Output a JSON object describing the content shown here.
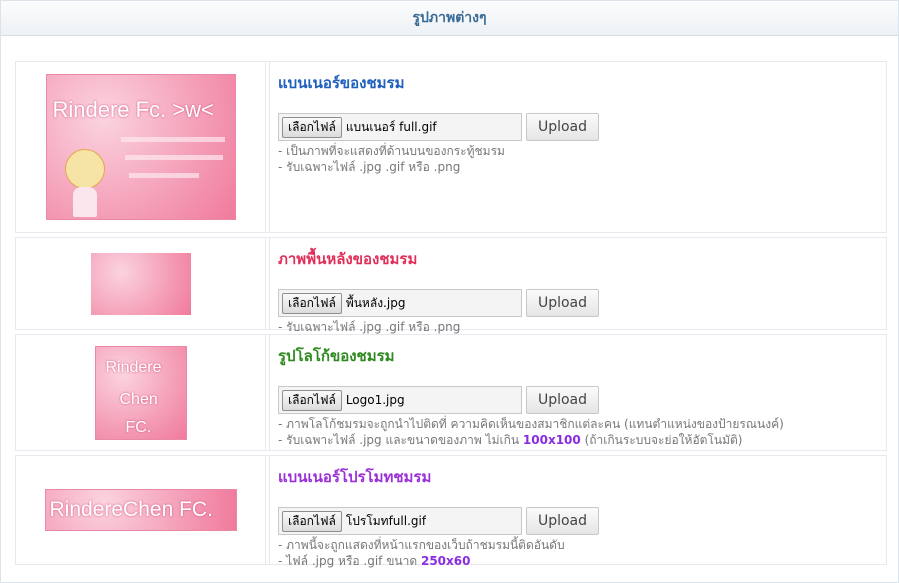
{
  "panel": {
    "title": "รูปภาพต่างๆ"
  },
  "colors": {
    "header_text": "#3a6b96",
    "blue": "#1f5fbf",
    "red": "#e0305a",
    "green": "#2e8a1f",
    "purple": "#9b30d9"
  },
  "rows": [
    {
      "heading": "แบนเนอร์ของชมรม",
      "choose_label": "เลือกไฟล์",
      "file_name": "แบนเนอร์ full.gif",
      "upload_label": "Upload",
      "notes": [
        "- เป็นภาพที่จะแสดงที่ด้านบนของกระทู้ชมรม",
        "- รับเฉพาะไฟล์ .jpg .gif หรือ .png"
      ],
      "thumb_text": "Rindere Fc. >w<"
    },
    {
      "heading": "ภาพพื้นหลังของชมรม",
      "choose_label": "เลือกไฟล์",
      "file_name": "พื้นหลัง.jpg",
      "upload_label": "Upload",
      "notes": [
        "- รับเฉพาะไฟล์ .jpg .gif หรือ .png"
      ]
    },
    {
      "heading": "รูปโลโก้ของชมรม",
      "choose_label": "เลือกไฟล์",
      "file_name": "Logo1.jpg",
      "upload_label": "Upload",
      "note1": "- ภาพโลโก้ชมรมจะถูกนำไปติดที่ ความคิดเห็นของสมาชิกแต่ละคน (แทนตำแหน่งของป้ายรณนงค์)",
      "note2_pre": "- รับเฉพาะไฟล์ .jpg และขนาดของภาพ ไม่เกิน ",
      "note2_bold": "100x100",
      "note2_post": " (ถ้าเกินระบบจะย่อให้อัตโนมัติ)",
      "thumb_lines": [
        "Rindere",
        "Chen",
        "FC."
      ]
    },
    {
      "heading": "แบนเนอร์โปรโมทชมรม",
      "choose_label": "เลือกไฟล์",
      "file_name": "โปรโมทfull.gif",
      "upload_label": "Upload",
      "note1": "- ภาพนี้จะถูกแสดงที่หน้าแรกของเว็บถ้าชมรมนี้ติดอันดับ",
      "note2_pre": "- ไฟล์ .jpg หรือ .gif ขนาด ",
      "note2_bold": "250x60",
      "thumb_text": "RindereChen FC."
    }
  ]
}
